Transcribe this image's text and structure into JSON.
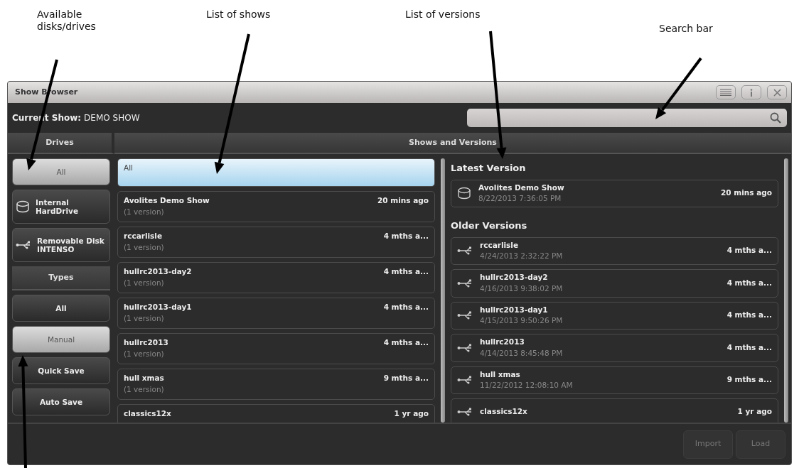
{
  "annotations": [
    {
      "text": "Available disks/drives",
      "kind": "drives"
    },
    {
      "text": "List of shows",
      "kind": "shows"
    },
    {
      "text": "List of versions",
      "kind": "versions"
    },
    {
      "text": "Search bar",
      "kind": "search"
    },
    {
      "kind": "types"
    }
  ],
  "window": {
    "title": "Show Browser"
  },
  "current_show": {
    "label": "Current Show:",
    "value": "DEMO SHOW"
  },
  "drives": {
    "header": "Drives",
    "items": [
      {
        "label": "All",
        "kind": "plain",
        "selected": true
      },
      {
        "label": "Internal HardDrive",
        "kind": "disk",
        "selected": false
      },
      {
        "label": "Removable Disk INTENSO",
        "kind": "usb",
        "selected": false
      }
    ]
  },
  "types": {
    "header": "Types",
    "items": [
      {
        "label": "All",
        "selected": false
      },
      {
        "label": "Manual",
        "selected": true
      },
      {
        "label": "Quick Save",
        "selected": false
      },
      {
        "label": "Auto Save",
        "selected": false
      }
    ]
  },
  "shows": {
    "header": "Shows and Versions",
    "items": [
      {
        "name": "All",
        "kind": "all",
        "selected": true
      },
      {
        "name": "Avolites Demo Show",
        "count": "(1 version)",
        "age": "20 mins ago",
        "kind": "show",
        "selected": false
      },
      {
        "name": "rccarlisle",
        "count": "(1 version)",
        "age": "4 mths a...",
        "kind": "show",
        "selected": false
      },
      {
        "name": "hullrc2013-day2",
        "count": "(1 version)",
        "age": "4 mths a...",
        "kind": "show",
        "selected": false
      },
      {
        "name": "hullrc2013-day1",
        "count": "(1 version)",
        "age": "4 mths a...",
        "kind": "show",
        "selected": false
      },
      {
        "name": "hullrc2013",
        "count": "(1 version)",
        "age": "4 mths a...",
        "kind": "show",
        "selected": false
      },
      {
        "name": "hull xmas",
        "count": "(1 version)",
        "age": "9 mths a...",
        "kind": "show",
        "selected": false
      },
      {
        "name": "classics12x",
        "age": "1 yr ago",
        "kind": "show",
        "selected": false
      }
    ]
  },
  "versions": {
    "latest_heading": "Latest Version",
    "latest": [
      {
        "name": "Avolites Demo Show",
        "date": "8/22/2013 7:36:05 PM",
        "age": "20 mins ago",
        "kind": "disk"
      }
    ],
    "older_heading": "Older Versions",
    "older": [
      {
        "name": "rccarlisle",
        "date": "4/24/2013 2:32:22 PM",
        "age": "4 mths a...",
        "kind": "usb"
      },
      {
        "name": "hullrc2013-day2",
        "date": "4/16/2013 9:38:02 PM",
        "age": "4 mths a...",
        "kind": "usb"
      },
      {
        "name": "hullrc2013-day1",
        "date": "4/15/2013 9:50:26 PM",
        "age": "4 mths a...",
        "kind": "usb"
      },
      {
        "name": "hullrc2013",
        "date": "4/14/2013 8:45:48 PM",
        "age": "4 mths a...",
        "kind": "usb"
      },
      {
        "name": "hull xmas",
        "date": "11/22/2012 12:08:10 AM",
        "age": "9 mths a...",
        "kind": "usb"
      },
      {
        "name": "classics12x",
        "age": "1 yr ago",
        "kind": "usb"
      }
    ]
  },
  "footer_buttons": [
    {
      "label": "Import",
      "disabled": true
    },
    {
      "label": "Load",
      "disabled": true
    }
  ]
}
